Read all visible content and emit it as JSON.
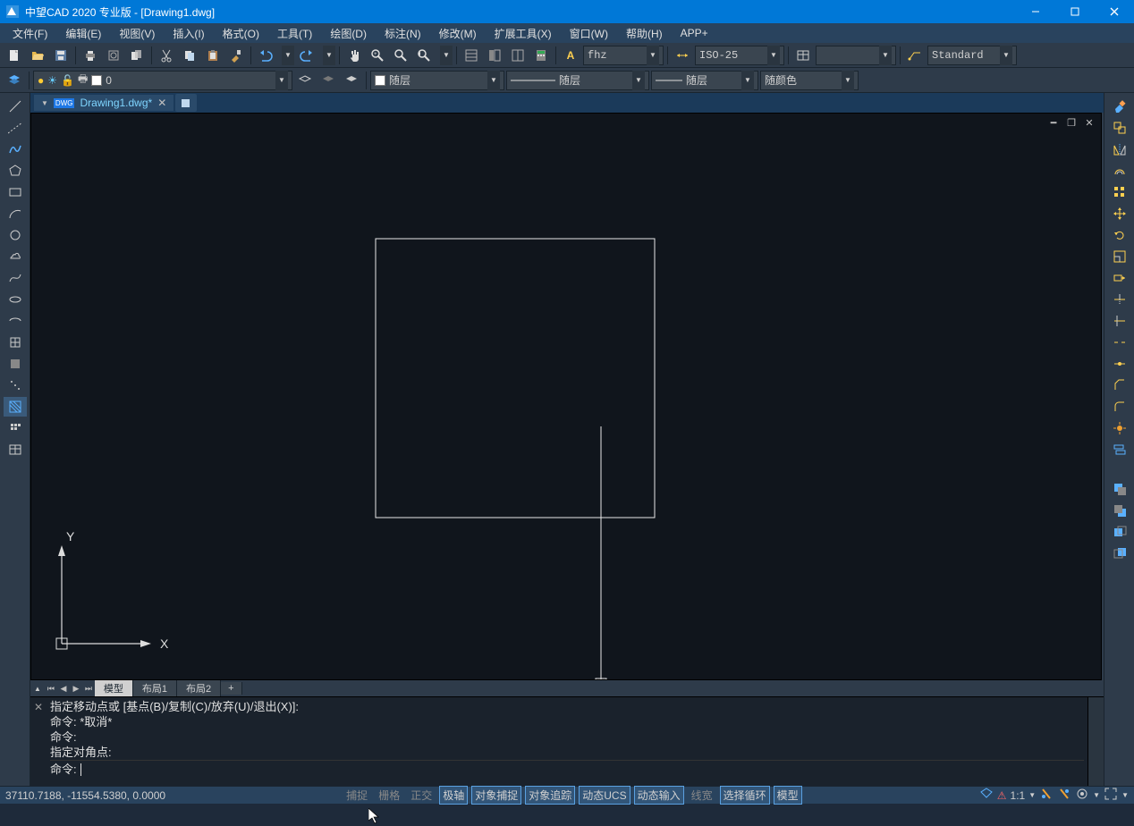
{
  "app": {
    "title": "中望CAD 2020 专业版 - [Drawing1.dwg]"
  },
  "menu": {
    "items": [
      "文件(F)",
      "编辑(E)",
      "视图(V)",
      "插入(I)",
      "格式(O)",
      "工具(T)",
      "绘图(D)",
      "标注(N)",
      "修改(M)",
      "扩展工具(X)",
      "窗口(W)",
      "帮助(H)",
      "APP+"
    ]
  },
  "toolbar_top": {
    "textstyle": "fhz",
    "dimstyle": "ISO-25",
    "tablestyle": "Standard"
  },
  "toolbar_props": {
    "layer_name": "0",
    "layer_color_label": "随层",
    "linetype_label": "随层",
    "lineweight_label": "随层",
    "plotstyle_label": "随颜色"
  },
  "doc_tabs": {
    "active": "Drawing1.dwg*"
  },
  "layout_tabs": {
    "model": "模型",
    "layout1": "布局1",
    "layout2": "布局2",
    "add": "+"
  },
  "command": {
    "history": [
      "指定移动点或 [基点(B)/复制(C)/放弃(U)/退出(X)]:",
      "命令: *取消*",
      "命令:",
      "指定对角点:"
    ],
    "prompt": "命令:",
    "input_value": ""
  },
  "statusbar": {
    "coords": "37110.7188, -11554.5380, 0.0000",
    "toggles": {
      "snap": "捕捉",
      "grid": "栅格",
      "ortho": "正交",
      "polar": "极轴",
      "osnap": "对象捕捉",
      "otrack": "对象追踪",
      "ducs": "动态UCS",
      "dyn": "动态输入",
      "lwt": "线宽",
      "cycle": "选择循环",
      "model": "模型"
    },
    "scale": "1:1"
  },
  "ucs": {
    "x_label": "X",
    "y_label": "Y"
  }
}
